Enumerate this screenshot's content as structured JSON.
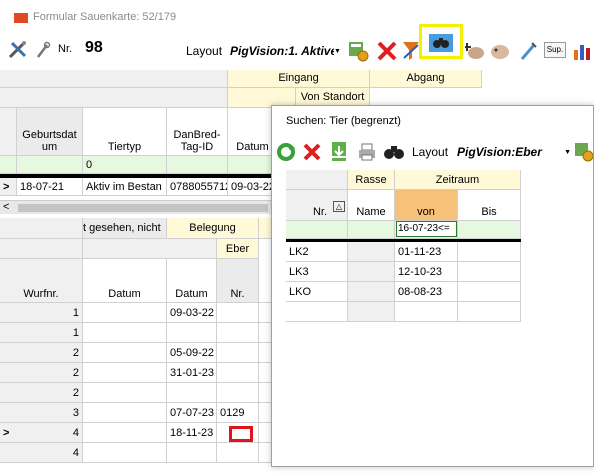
{
  "window": {
    "title": "Formular Sauenkarte: 52/179"
  },
  "toolbar": {
    "nr_label": "Nr.",
    "nr_value": "98",
    "layout_label": "Layout",
    "layout_value": "PigVision:1. Aktive",
    "sup_label": "Sup."
  },
  "top_grid": {
    "group_eingang": "Eingang",
    "group_abgang": "Abgang",
    "sub_von_standort": "Von Standort",
    "col_geburtsdatum": "Geburtsdat um",
    "col_tiertyp": "Tiertyp",
    "col_danbred": "DanBred- Tag-ID",
    "col_datum": "Datum",
    "filter_tiertyp": "0",
    "row_marker": ">",
    "row_geburtsdatum": "18-07-21",
    "row_tiertyp": "Aktiv im Bestan",
    "row_danbred": "0788055712",
    "row_datum": "09-03-22",
    "scroll_left": "<"
  },
  "bottom_grid": {
    "group_gesehen": "t gesehen, nicht",
    "group_belegung": "Belegung",
    "sub_eber": "Eber",
    "col_wurfnr": "Wurfnr.",
    "col_datum1": "Datum",
    "col_datum2": "Datum",
    "col_nr": "Nr.",
    "rows": [
      {
        "marker": "",
        "wurfnr": "1",
        "datum1": "",
        "datum2": "09-03-22",
        "nr": ""
      },
      {
        "marker": "",
        "wurfnr": "1",
        "datum1": "",
        "datum2": "",
        "nr": ""
      },
      {
        "marker": "",
        "wurfnr": "2",
        "datum1": "",
        "datum2": "05-09-22",
        "nr": ""
      },
      {
        "marker": "",
        "wurfnr": "2",
        "datum1": "",
        "datum2": "31-01-23",
        "nr": ""
      },
      {
        "marker": "",
        "wurfnr": "2",
        "datum1": "",
        "datum2": "",
        "nr": ""
      },
      {
        "marker": "",
        "wurfnr": "3",
        "datum1": "",
        "datum2": "07-07-23",
        "nr": "0129"
      },
      {
        "marker": ">",
        "wurfnr": "4",
        "datum1": "",
        "datum2": "18-11-23",
        "nr": ""
      },
      {
        "marker": "",
        "wurfnr": "4",
        "datum1": "",
        "datum2": "",
        "nr": ""
      }
    ]
  },
  "search_dialog": {
    "title": "Suchen: Tier (begrenzt)",
    "layout_label": "Layout",
    "layout_value": "PigVision:Eber",
    "group_rasse": "Rasse",
    "group_zeitraum": "Zeitraum",
    "col_nr": "Nr.",
    "col_name": "Name",
    "col_von": "von",
    "col_bis": "Bis",
    "filter_marker": ">",
    "filter_von": "16-07-23<=",
    "rows": [
      {
        "nr": "LK2",
        "name": "",
        "von": "01-11-23",
        "bis": ""
      },
      {
        "nr": "LK3",
        "name": "",
        "von": "12-10-23",
        "bis": ""
      },
      {
        "nr": "LKO",
        "name": "",
        "von": "08-08-23",
        "bis": ""
      }
    ]
  },
  "colors": {
    "highlight_yellow": "#f4f100",
    "highlight_red": "#e0141b",
    "filter_green": "#e6f8df",
    "header_yellow": "#fff9d8",
    "sort_orange": "#f6c27a"
  }
}
